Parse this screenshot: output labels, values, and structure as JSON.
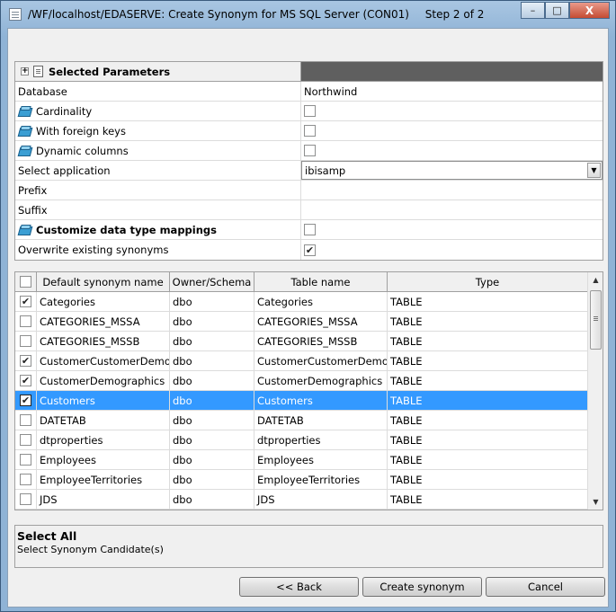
{
  "window": {
    "title": "/WF/localhost/EDASERVE: Create Synonym for MS SQL Server (CON01)",
    "step": "Step 2 of 2",
    "min_glyph": "–",
    "max_glyph": "□",
    "close_glyph": "X"
  },
  "params": {
    "header": "Selected Parameters",
    "rows": [
      {
        "label": "Database",
        "value": "Northwind"
      },
      {
        "label": "Cardinality",
        "checked": ""
      },
      {
        "label": "With foreign keys",
        "checked": ""
      },
      {
        "label": "Dynamic columns",
        "checked": ""
      },
      {
        "label": "Select application",
        "value": "ibisamp"
      },
      {
        "label": "Prefix",
        "value": ""
      },
      {
        "label": "Suffix",
        "value": ""
      },
      {
        "label": "Customize data type mappings",
        "checked": ""
      },
      {
        "label": "Overwrite existing synonyms",
        "checked": "✔"
      }
    ]
  },
  "table": {
    "headers": [
      "Default synonym name",
      "Owner/Schema",
      "Table name",
      "Type"
    ],
    "rows": [
      {
        "check": "✔",
        "name": "Categories",
        "owner": "dbo",
        "table": "Categories",
        "type": "TABLE"
      },
      {
        "check": "",
        "name": "CATEGORIES_MSSA",
        "owner": "dbo",
        "table": "CATEGORIES_MSSA",
        "type": "TABLE"
      },
      {
        "check": "",
        "name": "CATEGORIES_MSSB",
        "owner": "dbo",
        "table": "CATEGORIES_MSSB",
        "type": "TABLE"
      },
      {
        "check": "✔",
        "name": "CustomerCustomerDemo",
        "owner": "dbo",
        "table": "CustomerCustomerDemo",
        "type": "TABLE"
      },
      {
        "check": "✔",
        "name": "CustomerDemographics",
        "owner": "dbo",
        "table": "CustomerDemographics",
        "type": "TABLE"
      },
      {
        "check": "✔",
        "name": "Customers",
        "owner": "dbo",
        "table": "Customers",
        "type": "TABLE"
      },
      {
        "check": "",
        "name": "DATETAB",
        "owner": "dbo",
        "table": "DATETAB",
        "type": "TABLE"
      },
      {
        "check": "",
        "name": "dtproperties",
        "owner": "dbo",
        "table": "dtproperties",
        "type": "TABLE"
      },
      {
        "check": "",
        "name": "Employees",
        "owner": "dbo",
        "table": "Employees",
        "type": "TABLE"
      },
      {
        "check": "",
        "name": "EmployeeTerritories",
        "owner": "dbo",
        "table": "EmployeeTerritories",
        "type": "TABLE"
      },
      {
        "check": "",
        "name": "JDS",
        "owner": "dbo",
        "table": "JDS",
        "type": "TABLE"
      }
    ],
    "selected_row": "Customers"
  },
  "description": {
    "title": "Select All",
    "text": "Select Synonym Candidate(s)"
  },
  "buttons": {
    "back": "<< Back",
    "create": "Create synonym",
    "cancel": "Cancel"
  },
  "icons": {
    "expand": "+",
    "dropdown": "▼",
    "scroll_up": "▲",
    "scroll_down": "▼"
  },
  "colors": {
    "selection": "#3399ff",
    "header_dark": "#5f5f5f"
  }
}
